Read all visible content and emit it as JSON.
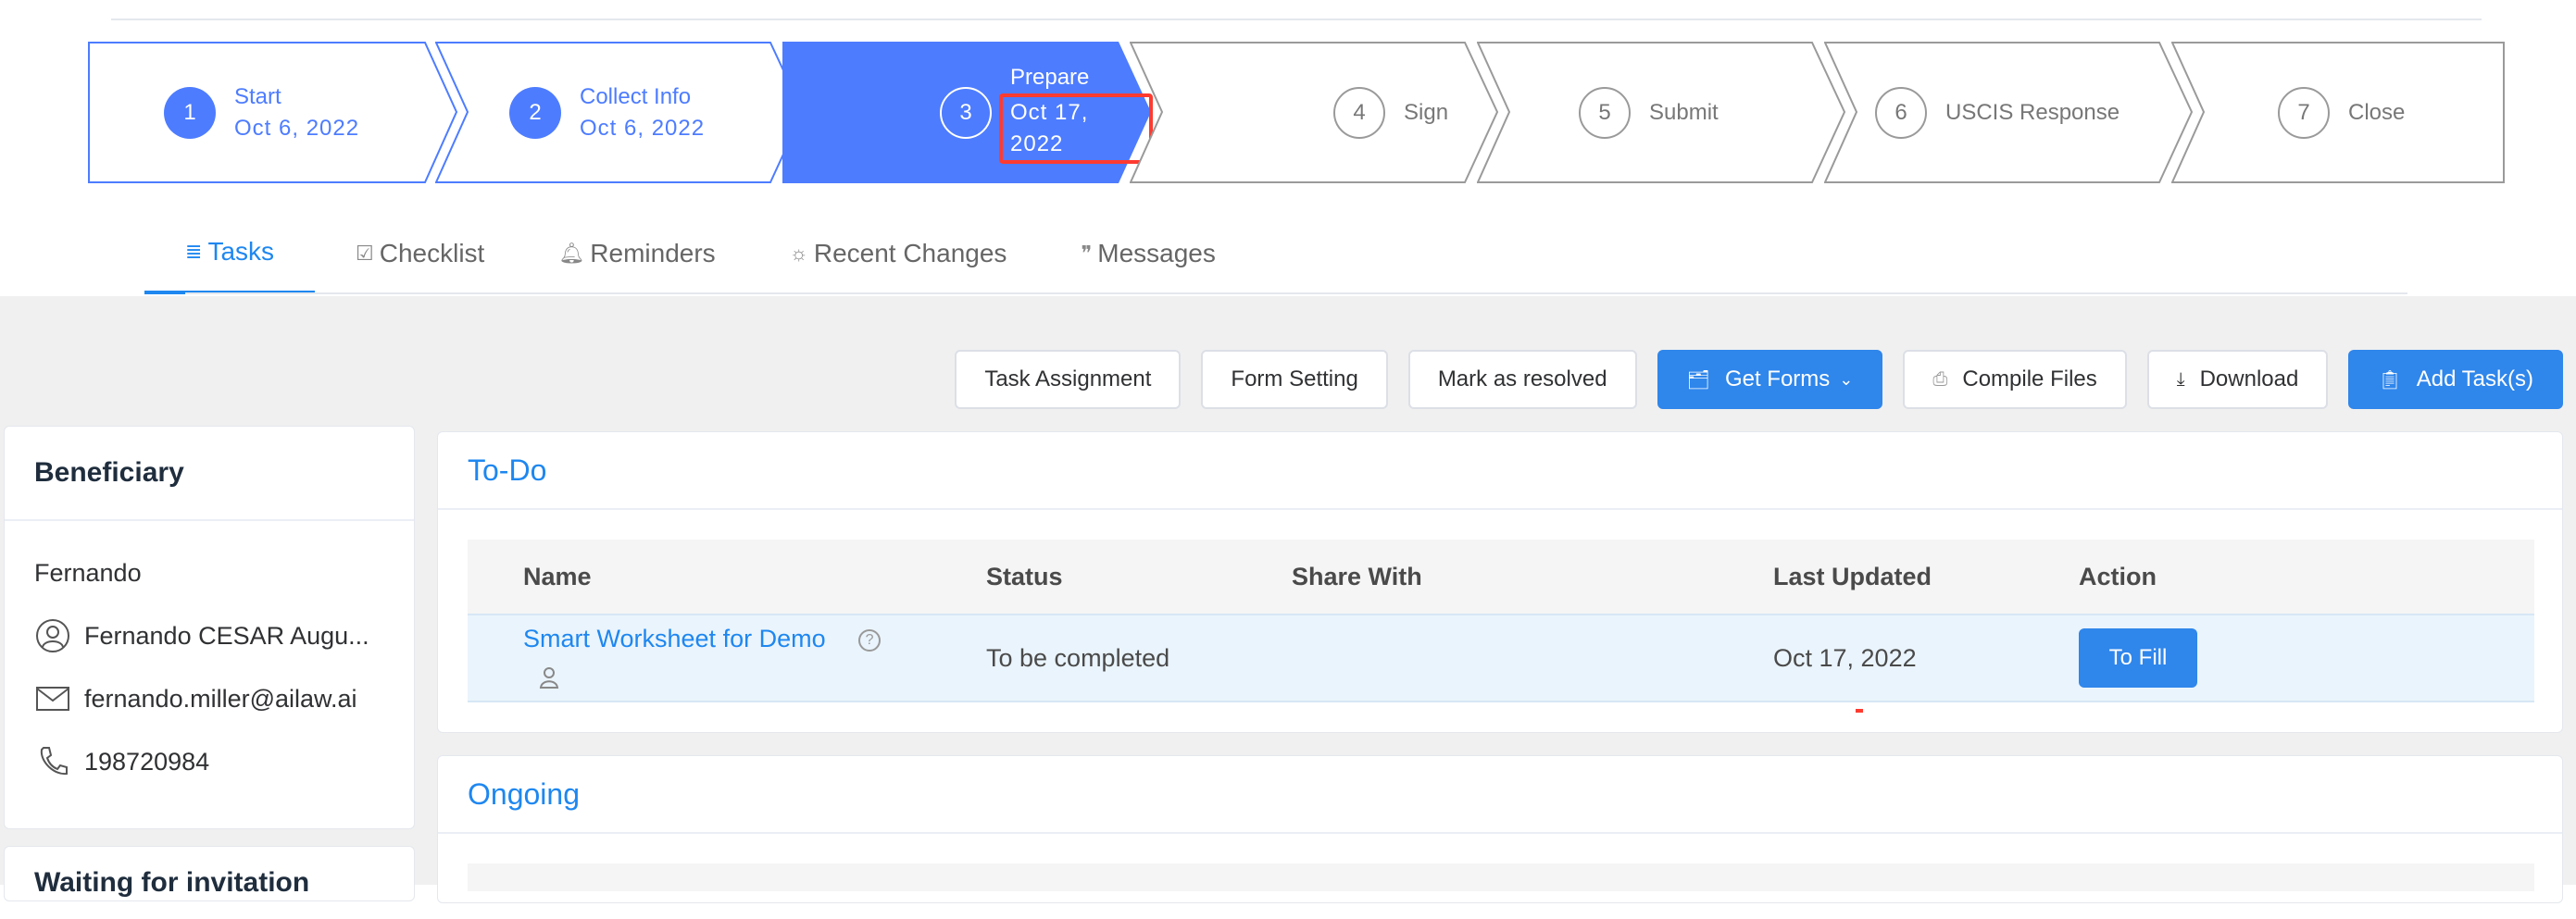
{
  "stepper": {
    "steps": [
      {
        "num": "1",
        "title": "Start",
        "date": "Oct 6, 2022"
      },
      {
        "num": "2",
        "title": "Collect Info",
        "date": "Oct 6, 2022"
      },
      {
        "num": "3",
        "title": "Prepare",
        "date": "Oct 17, 2022"
      },
      {
        "num": "4",
        "title": "Sign"
      },
      {
        "num": "5",
        "title": "Submit"
      },
      {
        "num": "6",
        "title": "USCIS Response"
      },
      {
        "num": "7",
        "title": "Close"
      }
    ]
  },
  "tabs": [
    {
      "label": "Tasks",
      "icon": "list-icon"
    },
    {
      "label": "Checklist",
      "icon": "checkbox-icon"
    },
    {
      "label": "Reminders",
      "icon": "bell-icon"
    },
    {
      "label": "Recent Changes",
      "icon": "bulb-icon"
    },
    {
      "label": "Messages",
      "icon": "quote-icon"
    }
  ],
  "toolbar": {
    "task_assignment": "Task Assignment",
    "form_setting": "Form Setting",
    "mark_resolved": "Mark as resolved",
    "get_forms": "Get Forms",
    "compile_files": "Compile Files",
    "download": "Download",
    "add_tasks": "Add Task(s)"
  },
  "beneficiary": {
    "title": "Beneficiary",
    "first_name": "Fernando",
    "full_name": "Fernando CESAR Augu...",
    "email": "fernando.miller@ailaw.ai",
    "phone": "198720984"
  },
  "waiting": {
    "title": "Waiting for invitation"
  },
  "todo": {
    "title": "To-Do",
    "columns": {
      "name": "Name",
      "status": "Status",
      "share": "Share With",
      "updated": "Last Updated",
      "action": "Action"
    },
    "rows": [
      {
        "name": "Smart Worksheet for Demo",
        "status": "To be completed",
        "share": "",
        "updated": "Oct 17, 2022",
        "action": "To Fill"
      }
    ]
  },
  "ongoing": {
    "title": "Ongoing"
  },
  "colors": {
    "primary": "#4d7cff",
    "button": "#2f86eb",
    "link": "#1e87f0",
    "highlight": "#ff3b30"
  }
}
